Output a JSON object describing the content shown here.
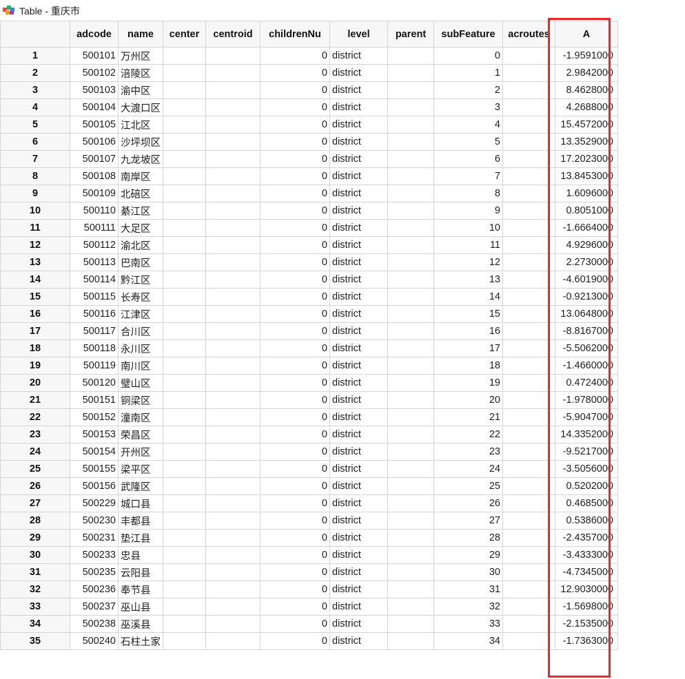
{
  "window": {
    "title": "Table - 重庆市",
    "icon": "table-app-icon"
  },
  "columns": [
    "adcode",
    "name",
    "center",
    "centroid",
    "childrenNu",
    "level",
    "parent",
    "subFeature",
    "acroutes",
    "A"
  ],
  "rows": [
    {
      "num": "1",
      "adcode": "500101",
      "name": "万州区",
      "center": "",
      "centroid": "",
      "childrenNum": "0",
      "level": "district",
      "parent": "",
      "subFeature": "0",
      "acroutes": "",
      "A": "-1.9591000"
    },
    {
      "num": "2",
      "adcode": "500102",
      "name": "涪陵区",
      "center": "",
      "centroid": "",
      "childrenNum": "0",
      "level": "district",
      "parent": "",
      "subFeature": "1",
      "acroutes": "",
      "A": "2.9842000"
    },
    {
      "num": "3",
      "adcode": "500103",
      "name": "渝中区",
      "center": "",
      "centroid": "",
      "childrenNum": "0",
      "level": "district",
      "parent": "",
      "subFeature": "2",
      "acroutes": "",
      "A": "8.4628000"
    },
    {
      "num": "4",
      "adcode": "500104",
      "name": "大渡口区",
      "center": "",
      "centroid": "",
      "childrenNum": "0",
      "level": "district",
      "parent": "",
      "subFeature": "3",
      "acroutes": "",
      "A": "4.2688000"
    },
    {
      "num": "5",
      "adcode": "500105",
      "name": "江北区",
      "center": "",
      "centroid": "",
      "childrenNum": "0",
      "level": "district",
      "parent": "",
      "subFeature": "4",
      "acroutes": "",
      "A": "15.4572000"
    },
    {
      "num": "6",
      "adcode": "500106",
      "name": "沙坪坝区",
      "center": "",
      "centroid": "",
      "childrenNum": "0",
      "level": "district",
      "parent": "",
      "subFeature": "5",
      "acroutes": "",
      "A": "13.3529000"
    },
    {
      "num": "7",
      "adcode": "500107",
      "name": "九龙坡区",
      "center": "",
      "centroid": "",
      "childrenNum": "0",
      "level": "district",
      "parent": "",
      "subFeature": "6",
      "acroutes": "",
      "A": "17.2023000"
    },
    {
      "num": "8",
      "adcode": "500108",
      "name": "南岸区",
      "center": "",
      "centroid": "",
      "childrenNum": "0",
      "level": "district",
      "parent": "",
      "subFeature": "7",
      "acroutes": "",
      "A": "13.8453000"
    },
    {
      "num": "9",
      "adcode": "500109",
      "name": "北碚区",
      "center": "",
      "centroid": "",
      "childrenNum": "0",
      "level": "district",
      "parent": "",
      "subFeature": "8",
      "acroutes": "",
      "A": "1.6096000"
    },
    {
      "num": "10",
      "adcode": "500110",
      "name": "綦江区",
      "center": "",
      "centroid": "",
      "childrenNum": "0",
      "level": "district",
      "parent": "",
      "subFeature": "9",
      "acroutes": "",
      "A": "0.8051000"
    },
    {
      "num": "11",
      "adcode": "500111",
      "name": "大足区",
      "center": "",
      "centroid": "",
      "childrenNum": "0",
      "level": "district",
      "parent": "",
      "subFeature": "10",
      "acroutes": "",
      "A": "-1.6664000"
    },
    {
      "num": "12",
      "adcode": "500112",
      "name": "渝北区",
      "center": "",
      "centroid": "",
      "childrenNum": "0",
      "level": "district",
      "parent": "",
      "subFeature": "11",
      "acroutes": "",
      "A": "4.9296000"
    },
    {
      "num": "13",
      "adcode": "500113",
      "name": "巴南区",
      "center": "",
      "centroid": "",
      "childrenNum": "0",
      "level": "district",
      "parent": "",
      "subFeature": "12",
      "acroutes": "",
      "A": "2.2730000"
    },
    {
      "num": "14",
      "adcode": "500114",
      "name": "黔江区",
      "center": "",
      "centroid": "",
      "childrenNum": "0",
      "level": "district",
      "parent": "",
      "subFeature": "13",
      "acroutes": "",
      "A": "-4.6019000"
    },
    {
      "num": "15",
      "adcode": "500115",
      "name": "长寿区",
      "center": "",
      "centroid": "",
      "childrenNum": "0",
      "level": "district",
      "parent": "",
      "subFeature": "14",
      "acroutes": "",
      "A": "-0.9213000"
    },
    {
      "num": "16",
      "adcode": "500116",
      "name": "江津区",
      "center": "",
      "centroid": "",
      "childrenNum": "0",
      "level": "district",
      "parent": "",
      "subFeature": "15",
      "acroutes": "",
      "A": "13.0648000"
    },
    {
      "num": "17",
      "adcode": "500117",
      "name": "合川区",
      "center": "",
      "centroid": "",
      "childrenNum": "0",
      "level": "district",
      "parent": "",
      "subFeature": "16",
      "acroutes": "",
      "A": "-8.8167000"
    },
    {
      "num": "18",
      "adcode": "500118",
      "name": "永川区",
      "center": "",
      "centroid": "",
      "childrenNum": "0",
      "level": "district",
      "parent": "",
      "subFeature": "17",
      "acroutes": "",
      "A": "-5.5062000"
    },
    {
      "num": "19",
      "adcode": "500119",
      "name": "南川区",
      "center": "",
      "centroid": "",
      "childrenNum": "0",
      "level": "district",
      "parent": "",
      "subFeature": "18",
      "acroutes": "",
      "A": "-1.4660000"
    },
    {
      "num": "20",
      "adcode": "500120",
      "name": "璧山区",
      "center": "",
      "centroid": "",
      "childrenNum": "0",
      "level": "district",
      "parent": "",
      "subFeature": "19",
      "acroutes": "",
      "A": "0.4724000"
    },
    {
      "num": "21",
      "adcode": "500151",
      "name": "铜梁区",
      "center": "",
      "centroid": "",
      "childrenNum": "0",
      "level": "district",
      "parent": "",
      "subFeature": "20",
      "acroutes": "",
      "A": "-1.9780000"
    },
    {
      "num": "22",
      "adcode": "500152",
      "name": "潼南区",
      "center": "",
      "centroid": "",
      "childrenNum": "0",
      "level": "district",
      "parent": "",
      "subFeature": "21",
      "acroutes": "",
      "A": "-5.9047000"
    },
    {
      "num": "23",
      "adcode": "500153",
      "name": "荣昌区",
      "center": "",
      "centroid": "",
      "childrenNum": "0",
      "level": "district",
      "parent": "",
      "subFeature": "22",
      "acroutes": "",
      "A": "14.3352000"
    },
    {
      "num": "24",
      "adcode": "500154",
      "name": "开州区",
      "center": "",
      "centroid": "",
      "childrenNum": "0",
      "level": "district",
      "parent": "",
      "subFeature": "23",
      "acroutes": "",
      "A": "-9.5217000"
    },
    {
      "num": "25",
      "adcode": "500155",
      "name": "梁平区",
      "center": "",
      "centroid": "",
      "childrenNum": "0",
      "level": "district",
      "parent": "",
      "subFeature": "24",
      "acroutes": "",
      "A": "-3.5056000"
    },
    {
      "num": "26",
      "adcode": "500156",
      "name": "武隆区",
      "center": "",
      "centroid": "",
      "childrenNum": "0",
      "level": "district",
      "parent": "",
      "subFeature": "25",
      "acroutes": "",
      "A": "0.5202000"
    },
    {
      "num": "27",
      "adcode": "500229",
      "name": "城口县",
      "center": "",
      "centroid": "",
      "childrenNum": "0",
      "level": "district",
      "parent": "",
      "subFeature": "26",
      "acroutes": "",
      "A": "0.4685000"
    },
    {
      "num": "28",
      "adcode": "500230",
      "name": "丰都县",
      "center": "",
      "centroid": "",
      "childrenNum": "0",
      "level": "district",
      "parent": "",
      "subFeature": "27",
      "acroutes": "",
      "A": "0.5386000"
    },
    {
      "num": "29",
      "adcode": "500231",
      "name": "垫江县",
      "center": "",
      "centroid": "",
      "childrenNum": "0",
      "level": "district",
      "parent": "",
      "subFeature": "28",
      "acroutes": "",
      "A": "-2.4357000"
    },
    {
      "num": "30",
      "adcode": "500233",
      "name": "忠县",
      "center": "",
      "centroid": "",
      "childrenNum": "0",
      "level": "district",
      "parent": "",
      "subFeature": "29",
      "acroutes": "",
      "A": "-3.4333000"
    },
    {
      "num": "31",
      "adcode": "500235",
      "name": "云阳县",
      "center": "",
      "centroid": "",
      "childrenNum": "0",
      "level": "district",
      "parent": "",
      "subFeature": "30",
      "acroutes": "",
      "A": "-4.7345000"
    },
    {
      "num": "32",
      "adcode": "500236",
      "name": "奉节县",
      "center": "",
      "centroid": "",
      "childrenNum": "0",
      "level": "district",
      "parent": "",
      "subFeature": "31",
      "acroutes": "",
      "A": "12.9030000"
    },
    {
      "num": "33",
      "adcode": "500237",
      "name": "巫山县",
      "center": "",
      "centroid": "",
      "childrenNum": "0",
      "level": "district",
      "parent": "",
      "subFeature": "32",
      "acroutes": "",
      "A": "-1.5698000"
    },
    {
      "num": "34",
      "adcode": "500238",
      "name": "巫溪县",
      "center": "",
      "centroid": "",
      "childrenNum": "0",
      "level": "district",
      "parent": "",
      "subFeature": "33",
      "acroutes": "",
      "A": "-2.1535000"
    },
    {
      "num": "35",
      "adcode": "500240",
      "name": "石柱土家",
      "center": "",
      "centroid": "",
      "childrenNum": "0",
      "level": "district",
      "parent": "",
      "subFeature": "34",
      "acroutes": "",
      "A": "-1.7363000"
    }
  ],
  "highlight": {
    "column": "A",
    "color": "#e8262c"
  }
}
